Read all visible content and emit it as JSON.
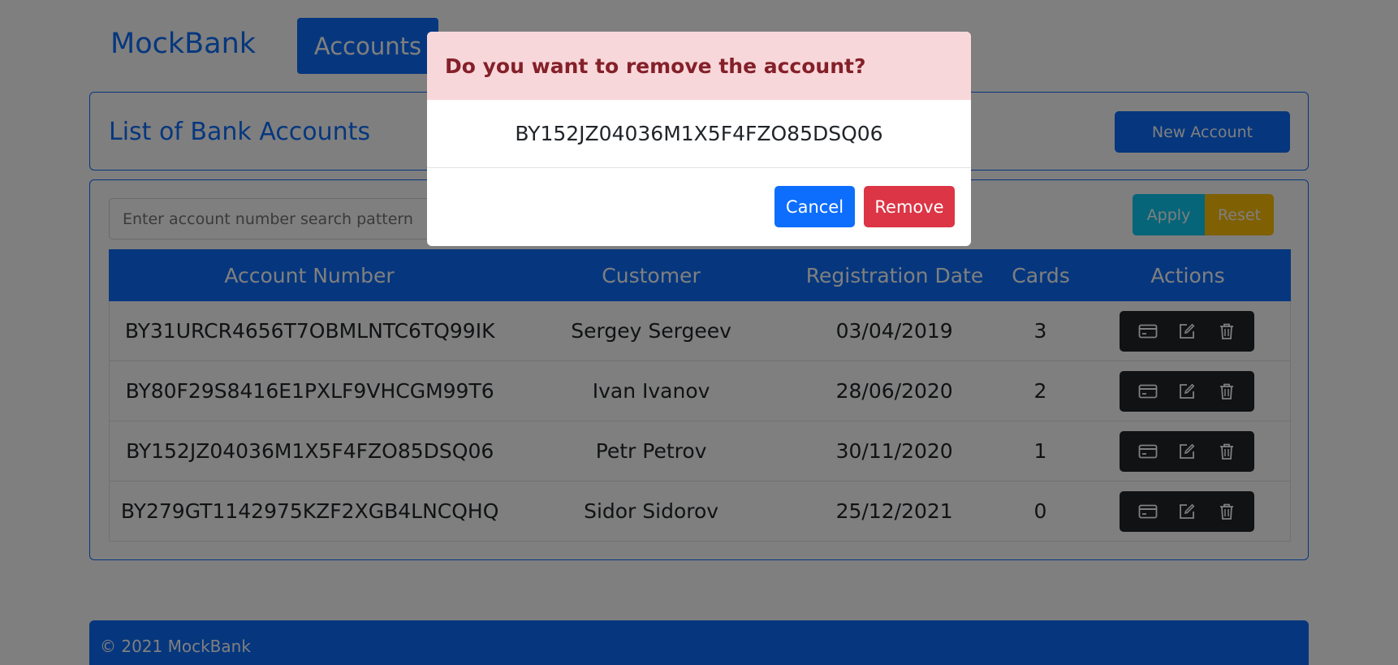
{
  "nav": {
    "brand": "MockBank",
    "accounts_tab": "Accounts"
  },
  "header": {
    "title": "List of Bank Accounts",
    "new_account_label": "New Account"
  },
  "filter": {
    "placeholder": "Enter account number search pattern",
    "apply_label": "Apply",
    "reset_label": "Reset"
  },
  "table": {
    "columns": [
      "Account Number",
      "Customer",
      "Registration Date",
      "Cards",
      "Actions"
    ],
    "rows": [
      {
        "account": "BY31URCR4656T7OBMLNTC6TQ99IK",
        "customer": "Sergey Sergeev",
        "date": "03/04/2019",
        "cards": "3"
      },
      {
        "account": "BY80F29S8416E1PXLF9VHCGM99T6",
        "customer": "Ivan Ivanov",
        "date": "28/06/2020",
        "cards": "2"
      },
      {
        "account": "BY152JZ04036M1X5F4FZO85DSQ06",
        "customer": "Petr Petrov",
        "date": "30/11/2020",
        "cards": "1"
      },
      {
        "account": "BY279GT1142975KZF2XGB4LNCQHQ",
        "customer": "Sidor Sidorov",
        "date": "25/12/2021",
        "cards": "0"
      }
    ]
  },
  "footer": {
    "text": "© 2021 MockBank"
  },
  "modal": {
    "title": "Do you want to remove the account?",
    "account": "BY152JZ04036M1X5F4FZO85DSQ06",
    "cancel_label": "Cancel",
    "remove_label": "Remove"
  },
  "colors": {
    "primary": "#0d6efd",
    "danger": "#dc3545",
    "info": "#0dcaf0",
    "warning": "#ffc107",
    "dark": "#212529",
    "alert_bg": "#f8d7da",
    "alert_text": "#842029"
  },
  "icons": [
    "credit-card-icon",
    "edit-icon",
    "trash-icon"
  ]
}
